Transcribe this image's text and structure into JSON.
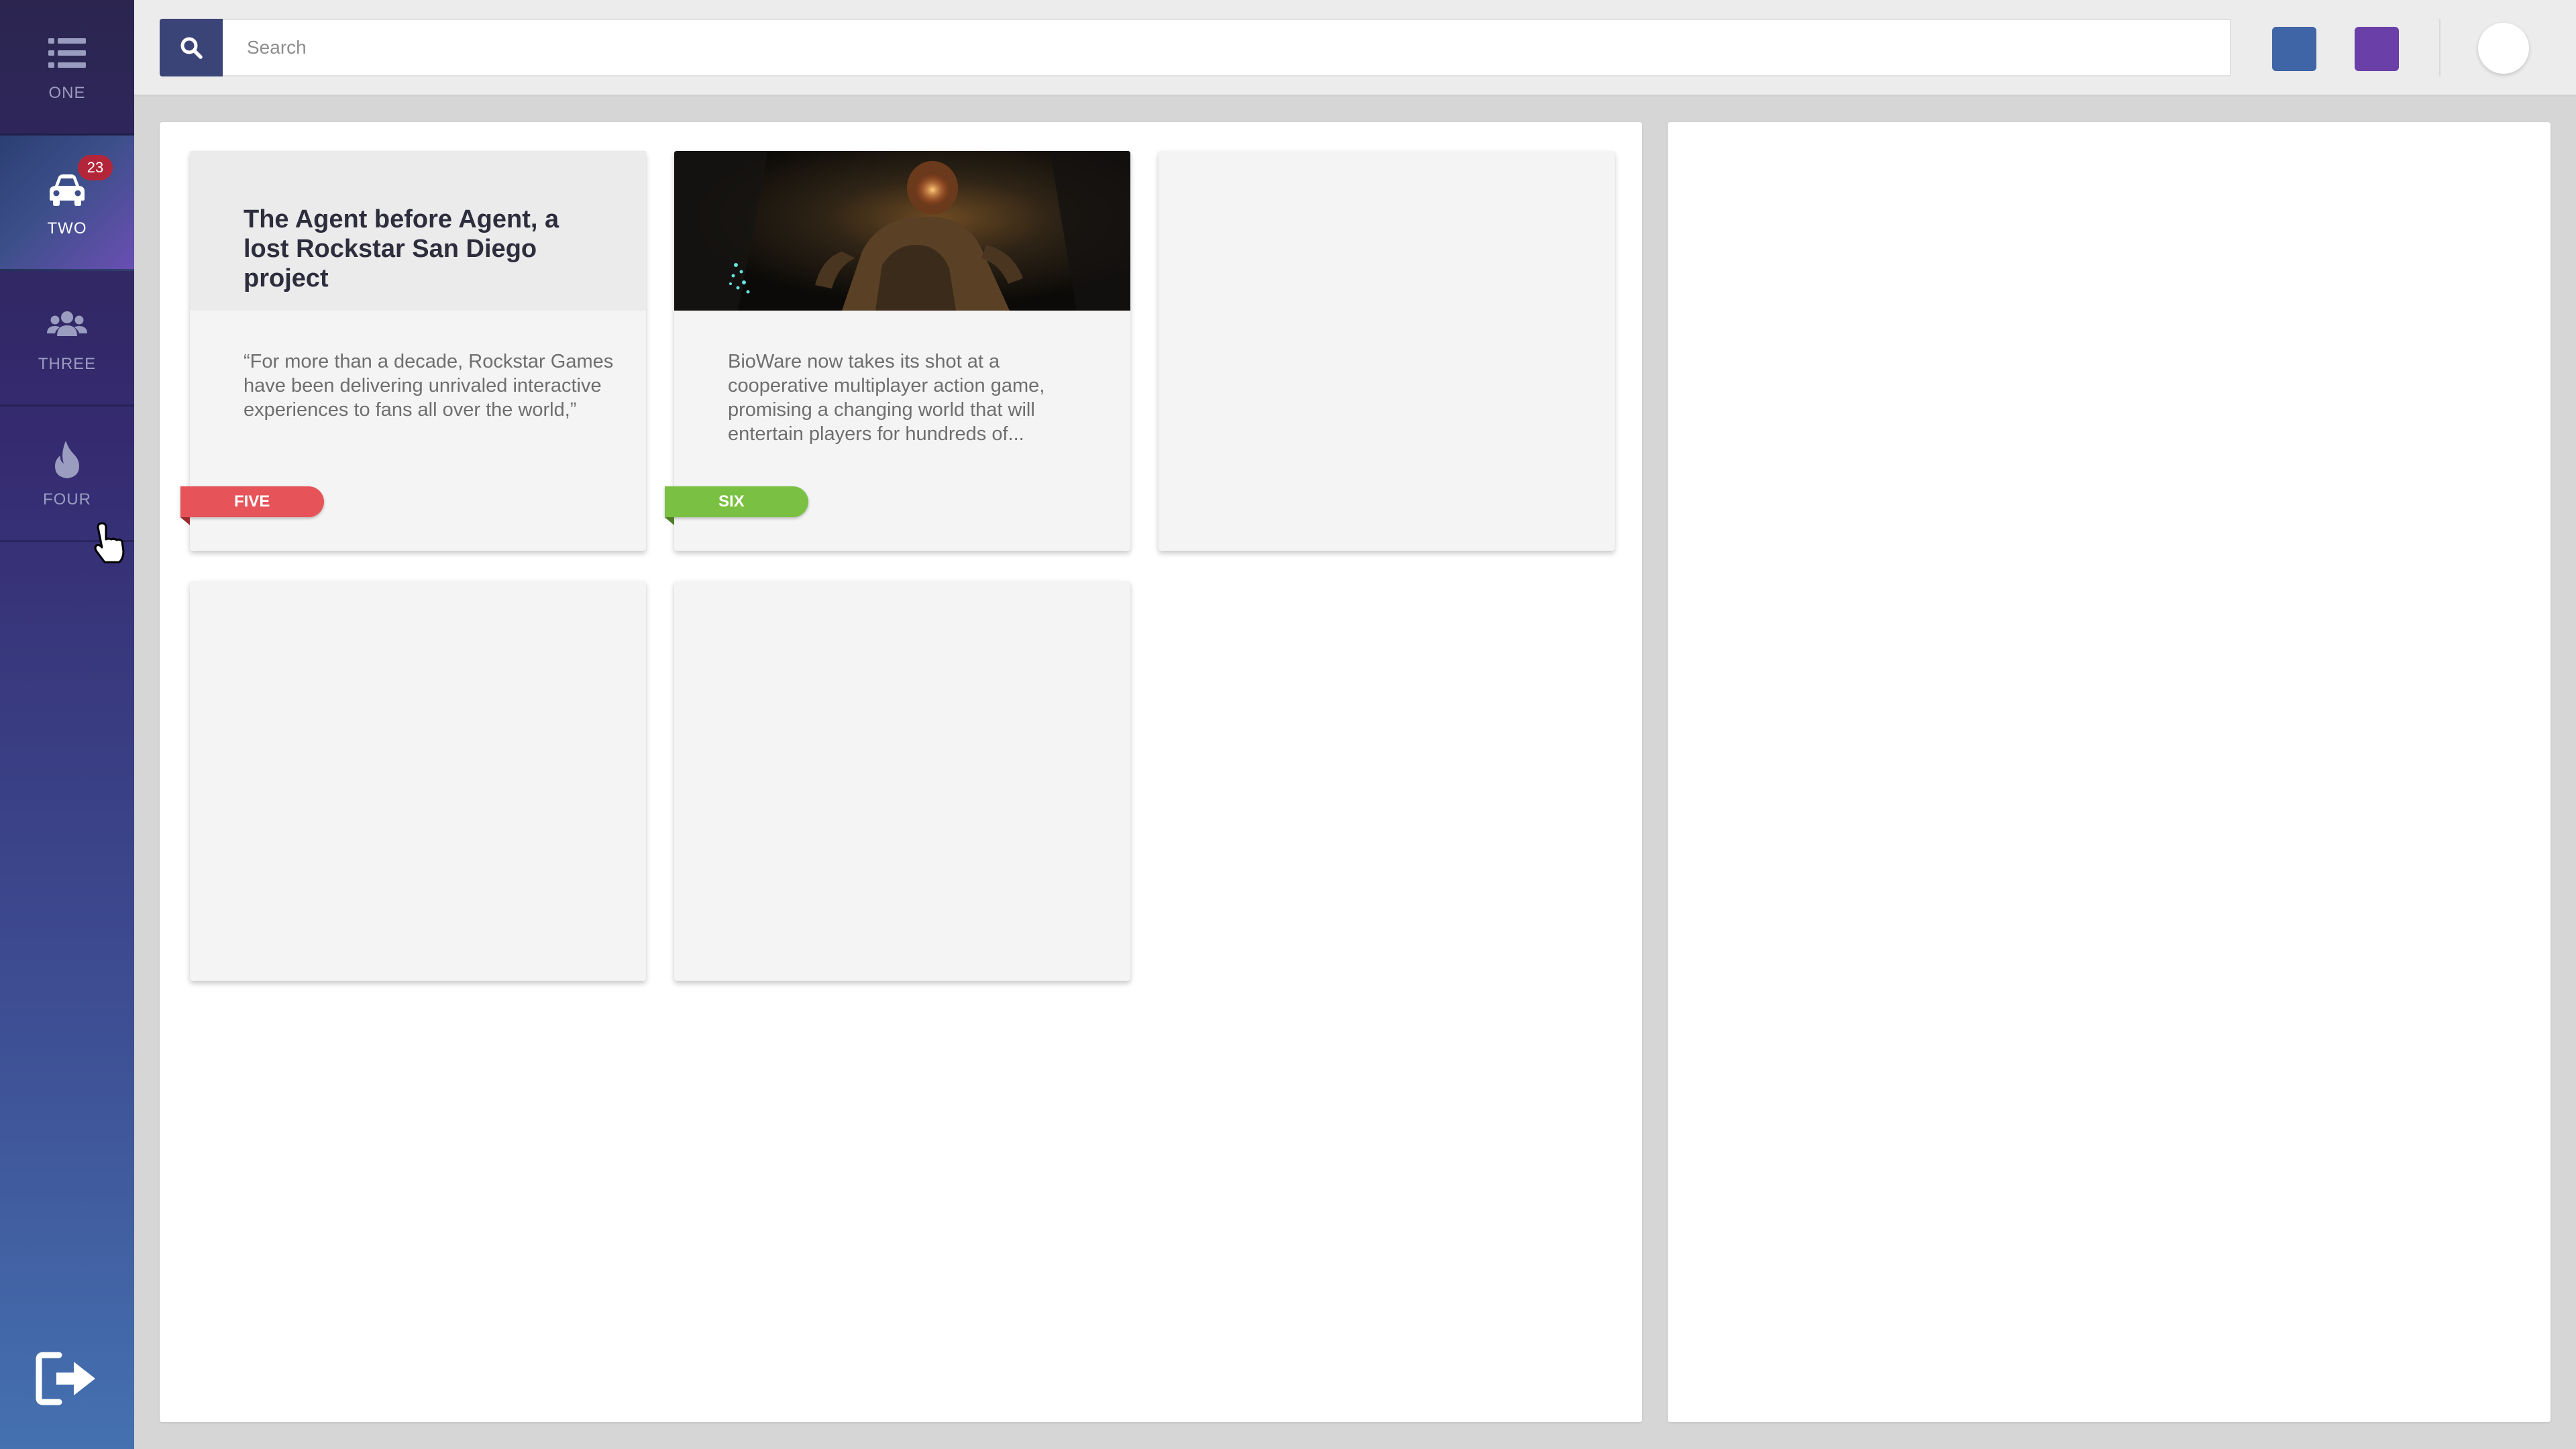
{
  "sidebar": {
    "items": [
      {
        "label": "ONE",
        "icon": "list-icon",
        "active": false
      },
      {
        "label": "TWO",
        "icon": "car-icon",
        "active": true,
        "badge": "23"
      },
      {
        "label": "THREE",
        "icon": "users-icon",
        "active": false
      },
      {
        "label": "FOUR",
        "icon": "fire-icon",
        "active": false
      }
    ],
    "logout_icon": "logout-icon"
  },
  "topbar": {
    "search": {
      "placeholder": "Search",
      "value": "",
      "icon": "search-icon"
    },
    "swatches": [
      "#3f65a6",
      "#6a3fa8"
    ]
  },
  "cards": [
    {
      "title": "The Agent before Agent, a lost Rockstar San Diego project",
      "text": "“For more than a decade, Rockstar Games have been delivering unrivaled interactive experiences to fans all over the world,”",
      "tag": "FIVE",
      "tag_color": "#e65459"
    },
    {
      "text": "BioWare now takes its shot at a cooperative multiplayer action game, promising a changing world that will entertain players for hundreds of...",
      "tag": "SIX",
      "tag_color": "#7ac143"
    },
    {},
    {},
    {}
  ],
  "colors": {
    "sidebar_top": "#2b2550",
    "sidebar_bottom": "#4471b0",
    "search_button": "#3b4477",
    "badge": "#b3263a"
  }
}
